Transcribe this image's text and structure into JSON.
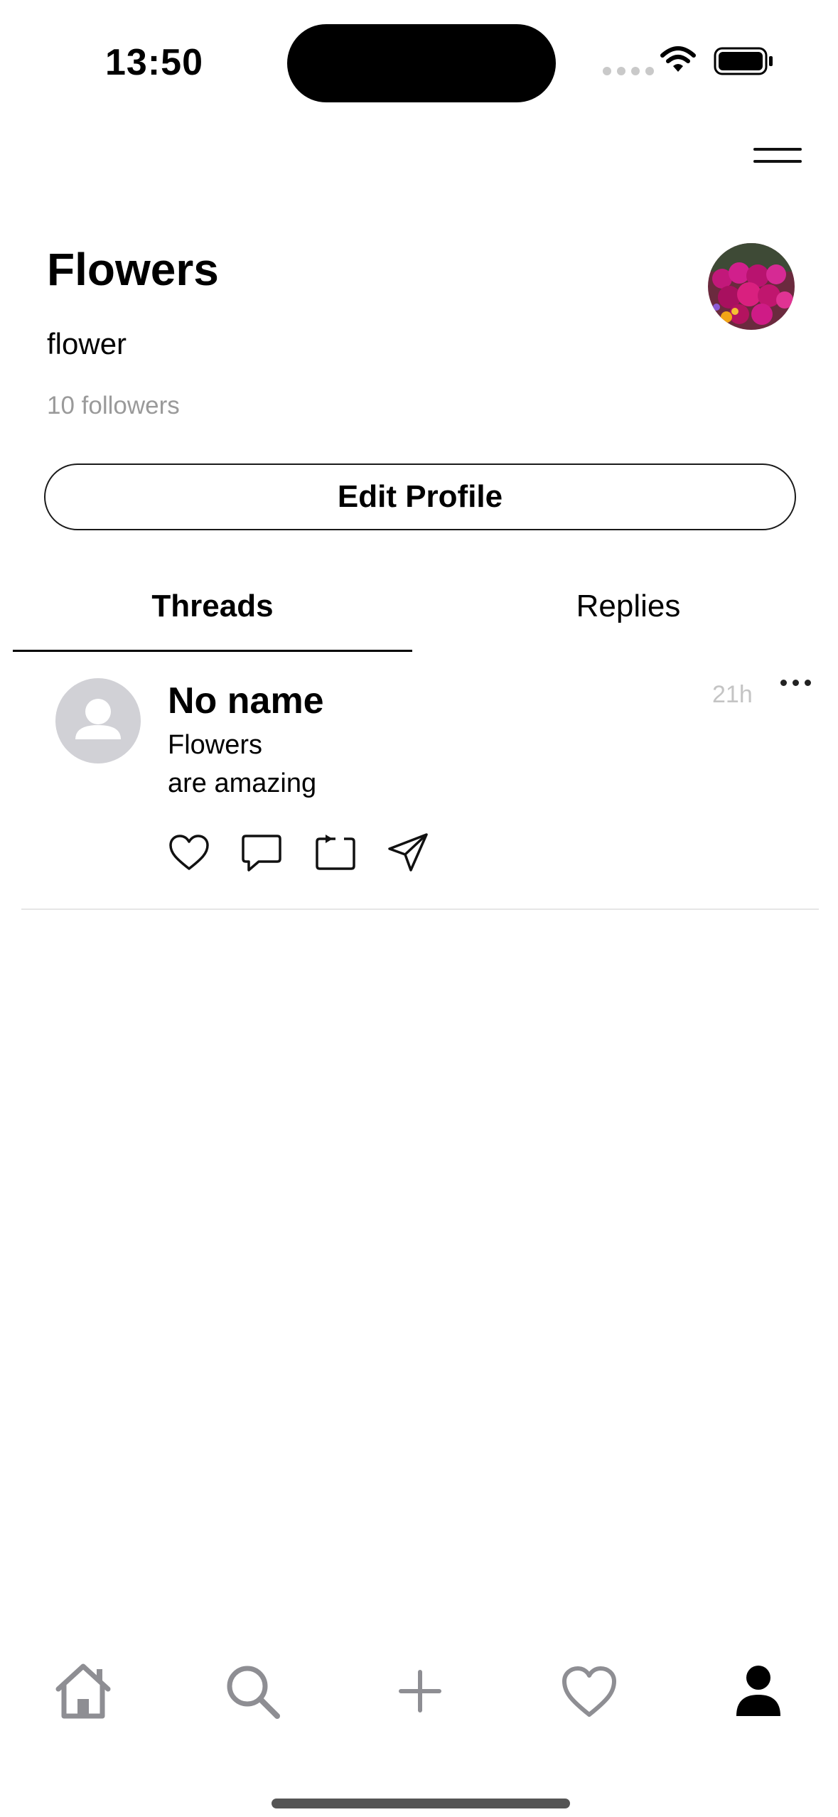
{
  "status_bar": {
    "time": "13:50"
  },
  "profile": {
    "name": "Flowers",
    "handle": "flower",
    "followers": "10 followers",
    "edit_label": "Edit Profile"
  },
  "tabs": [
    {
      "label": "Threads",
      "selected": true
    },
    {
      "label": "Replies",
      "selected": false
    }
  ],
  "post": {
    "author": "No name",
    "lines": [
      "Flowers",
      "are amazing"
    ],
    "time": "21h",
    "actions": [
      "heart-icon",
      "comment-icon",
      "repost-icon",
      "send-icon"
    ]
  },
  "tab_bar": {
    "items": [
      "home-icon",
      "search-icon",
      "plus-icon",
      "heart-icon",
      "profile-icon"
    ],
    "active": "profile-icon"
  },
  "colors": {
    "text": "#000000",
    "muted": "#9a9a9a",
    "timestamp": "#c4c4c4",
    "avatar_placeholder": "#d1d1d6",
    "inactive_icon": "#8e8e93"
  }
}
